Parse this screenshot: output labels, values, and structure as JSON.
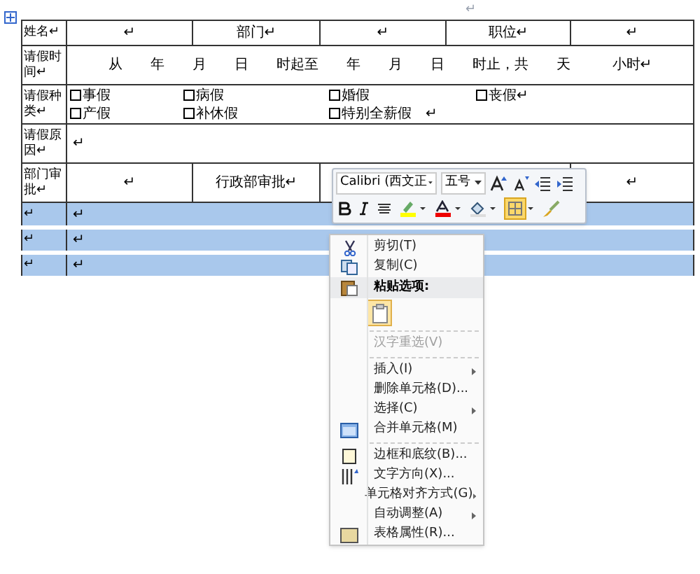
{
  "top_mark": "↵",
  "table": {
    "rows": [
      {
        "kind": "fields",
        "label": "姓名↵",
        "selected": false,
        "cells": [
          "↵",
          "部门↵",
          "↵",
          "职位↵",
          "↵"
        ]
      },
      {
        "kind": "line",
        "label": "请假时间↵",
        "selected": false,
        "cells": [
          "从　　年　　月　　日　　时起至　　年　　月　　日　　时止，共　　天　　　小时↵"
        ]
      },
      {
        "kind": "checks",
        "label": "请假种类↵",
        "selected": false,
        "checkboxes": [
          {
            "label": "事假",
            "checked": false
          },
          {
            "label": "病假",
            "checked": false
          },
          {
            "label": "婚假",
            "checked": false
          },
          {
            "label": "丧假↵",
            "checked": false
          },
          {
            "label": "产假",
            "checked": false
          },
          {
            "label": "补休假",
            "checked": false
          },
          {
            "label": "特别全薪假　↵",
            "checked": false
          }
        ]
      },
      {
        "kind": "line",
        "label": "请假原因↵",
        "selected": false,
        "cells": [
          "↵"
        ]
      },
      {
        "kind": "approval",
        "label": "部门审批↵",
        "selected": false,
        "cells": [
          "↵",
          "行政部审批↵",
          "↵"
        ]
      },
      {
        "kind": "line",
        "label": "↵",
        "selected": true,
        "cells": [
          "↵"
        ]
      },
      {
        "kind": "line",
        "label": "↵",
        "selected": true,
        "cells": [
          "↵"
        ]
      },
      {
        "kind": "line",
        "label": "↵",
        "selected": true,
        "cells": [
          "↵"
        ]
      }
    ]
  },
  "mini_toolbar": {
    "font": "Calibri (西文正",
    "size": "五号"
  },
  "context_menu": [
    {
      "kind": "item",
      "label": "剪切(T)",
      "disabled": false,
      "submenu": false
    },
    {
      "kind": "item",
      "label": "复制(C)",
      "disabled": false,
      "submenu": false
    },
    {
      "kind": "header",
      "label": "粘贴选项:"
    },
    {
      "kind": "paste"
    },
    {
      "kind": "separator"
    },
    {
      "kind": "item",
      "label": "汉字重选(V)",
      "disabled": true,
      "submenu": false
    },
    {
      "kind": "separator"
    },
    {
      "kind": "item",
      "label": "插入(I)",
      "disabled": false,
      "submenu": true
    },
    {
      "kind": "item",
      "label": "删除单元格(D)...",
      "disabled": false,
      "submenu": false
    },
    {
      "kind": "item",
      "label": "选择(C)",
      "disabled": false,
      "submenu": true
    },
    {
      "kind": "item",
      "label": "合并单元格(M)",
      "disabled": false,
      "submenu": false
    },
    {
      "kind": "separator"
    },
    {
      "kind": "item",
      "label": "边框和底纹(B)...",
      "disabled": false,
      "submenu": false
    },
    {
      "kind": "item",
      "label": "文字方向(X)...",
      "disabled": false,
      "submenu": false
    },
    {
      "kind": "item",
      "label": "单元格对齐方式(G)",
      "disabled": false,
      "submenu": true
    },
    {
      "kind": "item",
      "label": "自动调整(A)",
      "disabled": false,
      "submenu": true
    },
    {
      "kind": "item",
      "label": "表格属性(R)...",
      "disabled": false,
      "submenu": false
    }
  ]
}
